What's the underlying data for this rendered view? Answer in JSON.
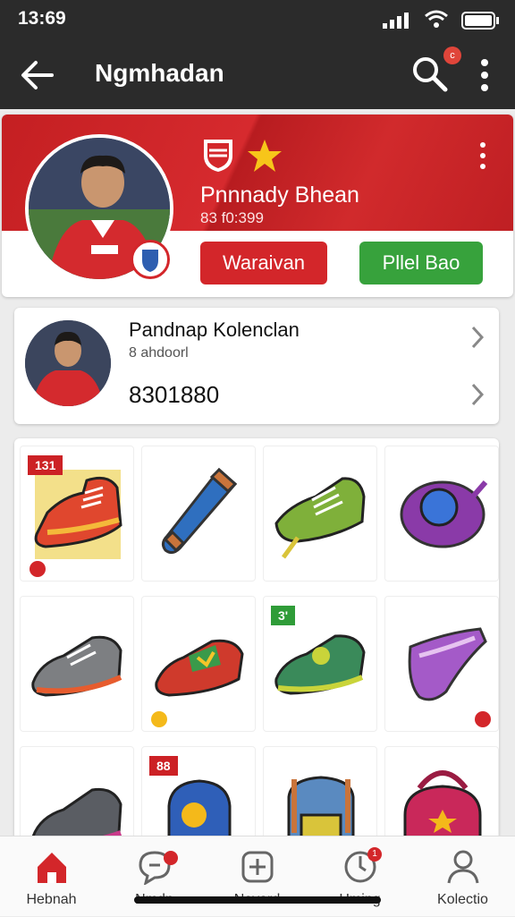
{
  "status": {
    "time": "13:69"
  },
  "appbar": {
    "title": "Nɡmhadan",
    "search_badge": "c"
  },
  "profile": {
    "name": "Pnnnady Bhean",
    "sub": "83 f0:399",
    "btn_primary": "Waraivan",
    "btn_secondary": "Pllel Bao"
  },
  "card": {
    "name": "Pandnap Kolenclan",
    "sub": "8 ahdoorl",
    "value": "8301880"
  },
  "grid": {
    "tags": [
      "131",
      "3'",
      "88"
    ]
  },
  "nav": {
    "items": [
      {
        "label": "Hebnah",
        "icon": "home-icon"
      },
      {
        "label": "Nmdn",
        "icon": "chat-icon"
      },
      {
        "label": "Nevard",
        "icon": "add-square-icon"
      },
      {
        "label": "Hming",
        "icon": "timer-icon"
      },
      {
        "label": "Kolectio",
        "icon": "person-icon"
      }
    ]
  },
  "colors": {
    "accent": "#d3262a",
    "green": "#37a23c",
    "bar": "#2b2b2b"
  }
}
